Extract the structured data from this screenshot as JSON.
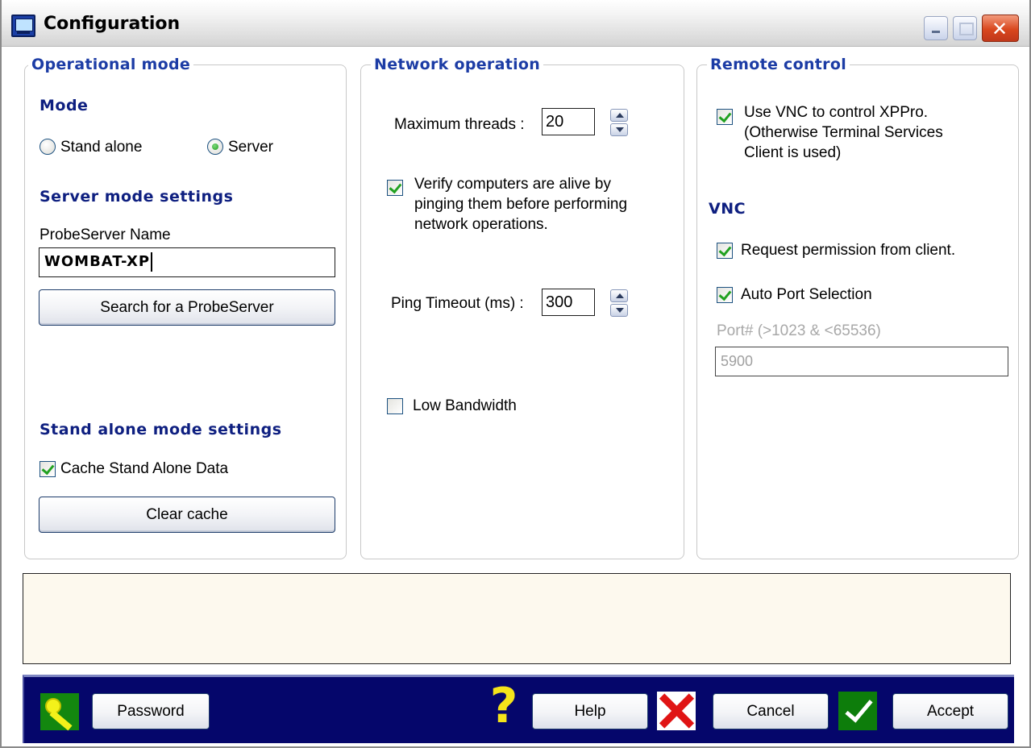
{
  "window": {
    "title": "Configuration"
  },
  "operational": {
    "legend": "Operational mode",
    "mode_heading": "Mode",
    "radio_standalone": "Stand alone",
    "radio_server": "Server",
    "selected_mode": "Server",
    "server_heading": "Server mode settings",
    "probeserver_label": "ProbeServer Name",
    "probeserver_value": "WOMBAT-XP",
    "search_button": "Search for a ProbeServer",
    "standalone_heading": "Stand alone mode settings",
    "cache_checkbox": "Cache Stand Alone Data",
    "cache_checked": true,
    "clear_button": "Clear cache"
  },
  "network": {
    "legend": "Network operation",
    "max_threads_label": "Maximum threads :",
    "max_threads_value": "20",
    "verify_line1": "Verify computers are alive by",
    "verify_line2": "pinging them before performing",
    "verify_line3": "network operations.",
    "verify_checked": true,
    "ping_timeout_label": "Ping Timeout (ms) :",
    "ping_timeout_value": "300",
    "low_bandwidth": "Low Bandwidth",
    "low_bandwidth_checked": false
  },
  "remote": {
    "legend": "Remote control",
    "vnc_line1": "Use VNC to control XPPro.",
    "vnc_line2": "(Otherwise Terminal Services",
    "vnc_line3": "Client is used)",
    "vnc_checked": true,
    "vnc_heading": "VNC",
    "request_permission": "Request permission from client.",
    "request_checked": true,
    "auto_port": "Auto Port Selection",
    "auto_port_checked": true,
    "port_label": "Port# (>1023 & <65536)",
    "port_value": "5900"
  },
  "footer": {
    "password_button": "Password",
    "help_button": "Help",
    "cancel_button": "Cancel",
    "accept_button": "Accept"
  },
  "icons": {
    "app": "computer-icon",
    "password": "key-icon",
    "help": "question-mark-icon",
    "cancel": "red-x-icon",
    "accept": "green-check-icon"
  },
  "colors": {
    "legend_text": "#1c3ca5",
    "heading_text": "#0e1f80",
    "footer_bar": "#05066b",
    "status_panel": "#fdf9ee",
    "check_mark": "#21a121"
  }
}
